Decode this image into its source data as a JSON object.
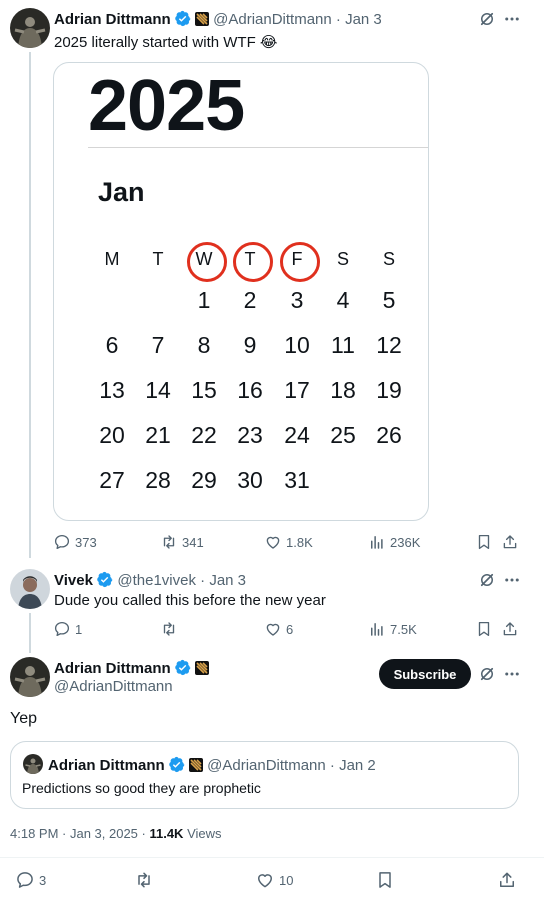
{
  "tweet1": {
    "name": "Adrian Dittmann",
    "handle_time": "@AdrianDittmann · Jan 3",
    "text": "2025 literally started with WTF 😂",
    "media": {
      "year": "2025",
      "month": "Jan",
      "weekdays": [
        "M",
        "T",
        "W",
        "T",
        "F",
        "S",
        "S"
      ],
      "circled_weekdays": [
        2,
        3,
        4
      ],
      "weeks": [
        [
          "",
          "",
          "1",
          "2",
          "3",
          "4",
          "5"
        ],
        [
          "6",
          "7",
          "8",
          "9",
          "10",
          "11",
          "12"
        ],
        [
          "13",
          "14",
          "15",
          "16",
          "17",
          "18",
          "19"
        ],
        [
          "20",
          "21",
          "22",
          "23",
          "24",
          "25",
          "26"
        ],
        [
          "27",
          "28",
          "29",
          "30",
          "31",
          "",
          ""
        ]
      ],
      "circle_color": "#e0301e"
    },
    "replies": "373",
    "reposts": "341",
    "likes": "1.8K",
    "views": "236K"
  },
  "tweet2": {
    "name": "Vivek",
    "handle_time": "@the1vivek · Jan 3",
    "text": "Dude you called this before the new year",
    "replies": "1",
    "reposts": "",
    "likes": "6",
    "views": "7.5K"
  },
  "main_tweet": {
    "name": "Adrian Dittmann",
    "handle": "@AdrianDittmann",
    "subscribe_label": "Subscribe",
    "text": "Yep",
    "quote": {
      "name": "Adrian Dittmann",
      "handle_time": "@AdrianDittmann · Jan 2",
      "text": "Predictions so good they are prophetic"
    },
    "timestamp": "4:18 PM · Jan 3, 2025 · ",
    "views_count": "11.4K",
    "views_label": " Views",
    "replies": "3",
    "reposts": "",
    "likes": "10"
  },
  "colors": {
    "verified": "#1d9bf0",
    "muted": "#536471",
    "border": "#cfd9de"
  },
  "icons": [
    "grok-icon",
    "more-icon",
    "reply-icon",
    "repost-icon",
    "like-icon",
    "views-icon",
    "bookmark-icon",
    "share-icon",
    "verified-badge-icon",
    "affiliate-badge-icon"
  ]
}
